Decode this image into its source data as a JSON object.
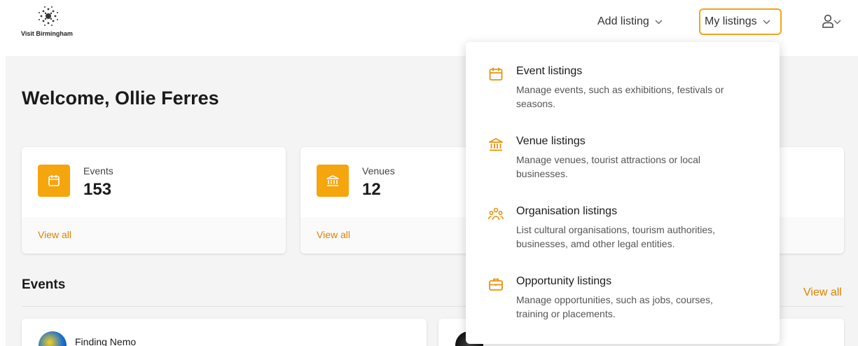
{
  "brand": {
    "logo_text": "Visit Birmingham"
  },
  "nav": {
    "add_listing": "Add listing",
    "my_listings": "My listings"
  },
  "welcome": "Welcome, Ollie Ferres",
  "stats": [
    {
      "label": "Events",
      "value": "153",
      "link": "View all",
      "icon": "calendar-icon"
    },
    {
      "label": "Venues",
      "value": "12",
      "link": "View all",
      "icon": "building-icon"
    }
  ],
  "events_section": {
    "heading": "Events",
    "view_all": "View all",
    "cards": [
      {
        "title": "Finding Nemo"
      },
      {
        "title": ""
      }
    ]
  },
  "dropdown": {
    "items": [
      {
        "title": "Event listings",
        "desc": "Manage events, such as exhibitions, festivals or seasons.",
        "icon": "calendar-icon"
      },
      {
        "title": "Venue listings",
        "desc": "Manage venues, tourist attractions or local businesses.",
        "icon": "building-icon"
      },
      {
        "title": "Organisation listings",
        "desc": "List cultural organisations, tourism authorities, businesses, amd other legal entities.",
        "icon": "people-group-icon"
      },
      {
        "title": "Opportunity listings",
        "desc": "Manage opportunities, such as jobs, courses, training or placements.",
        "icon": "briefcase-icon"
      }
    ]
  },
  "colors": {
    "accent": "#f5a50d",
    "link": "#d88400",
    "focus_border": "#f0a41c"
  }
}
